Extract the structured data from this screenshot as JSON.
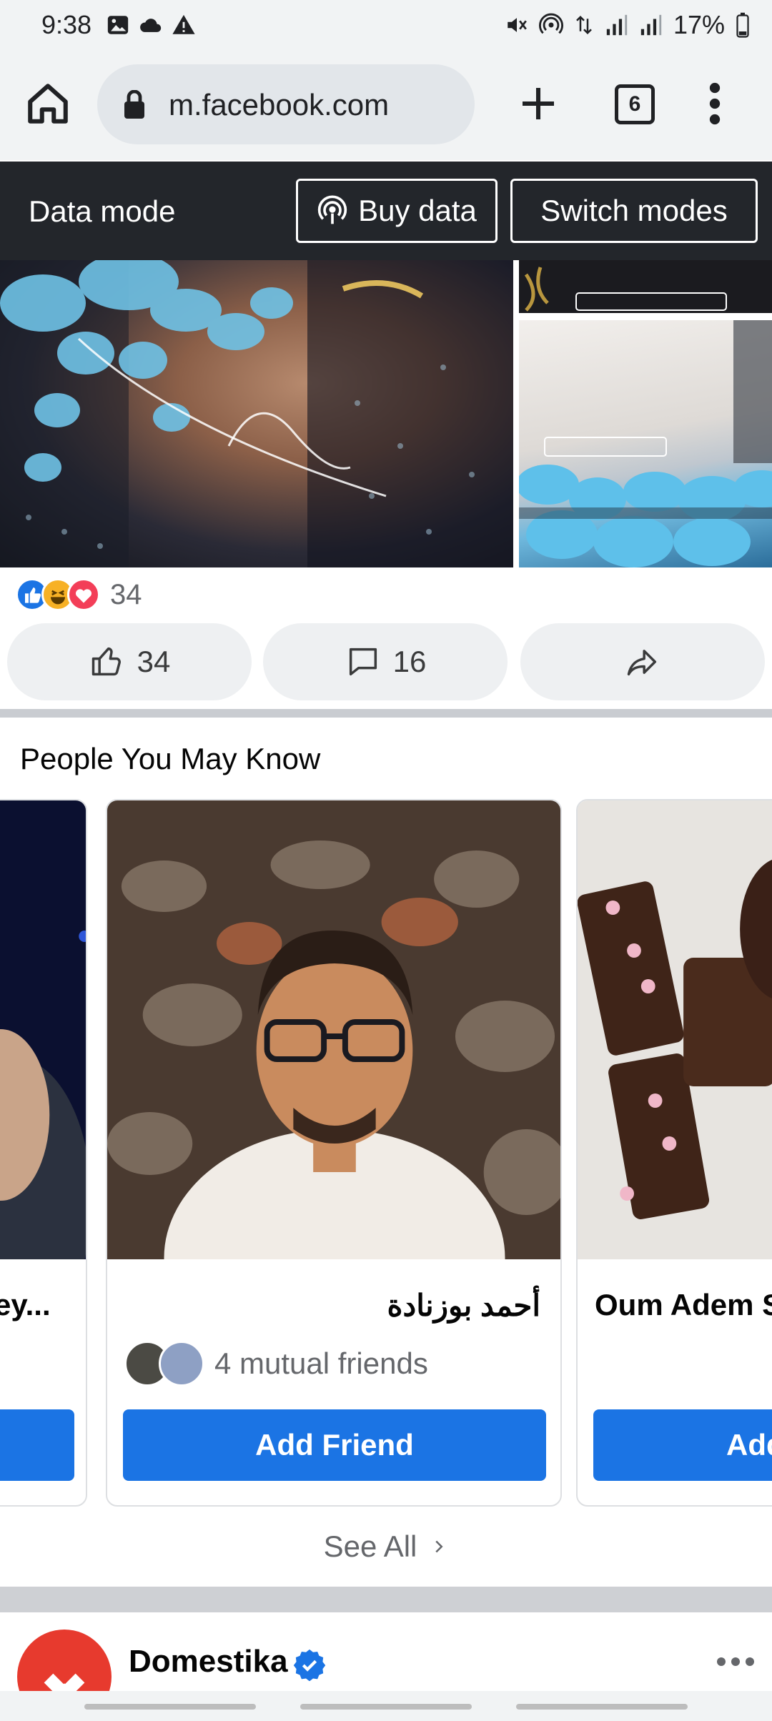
{
  "status_bar": {
    "time": "9:38",
    "battery": "17%",
    "left_icons": [
      "gallery-icon",
      "cloud-icon",
      "warning-icon"
    ],
    "right_icons": [
      "mute-icon",
      "hotspot-icon",
      "data-arrows-icon",
      "signal-icon",
      "signal-icon",
      "battery-icon"
    ]
  },
  "browser": {
    "url": "m.facebook.com",
    "tab_count": "6",
    "icons": [
      "home-icon",
      "lock-icon",
      "plus-icon",
      "tabs-icon",
      "more-vert-icon"
    ]
  },
  "data_mode": {
    "label": "Data mode",
    "buy_label": "Buy data",
    "switch_label": "Switch modes"
  },
  "post": {
    "reaction_count": "34",
    "reaction_icons": [
      "like-icon",
      "haha-icon",
      "love-icon"
    ],
    "like_count": "34",
    "comment_count": "16",
    "accent_color": "#1b74e4"
  },
  "pymk": {
    "title": "People You May Know",
    "cards": [
      {
        "name": "ey...",
        "button": ""
      },
      {
        "name": "أحمد بوزنادة",
        "mutual": "4 mutual friends",
        "button": "Add Friend"
      },
      {
        "name": "Oum Adem S",
        "button": "Add"
      }
    ],
    "see_all": "See All"
  },
  "next_post": {
    "name": "Domestika",
    "verified": true
  }
}
